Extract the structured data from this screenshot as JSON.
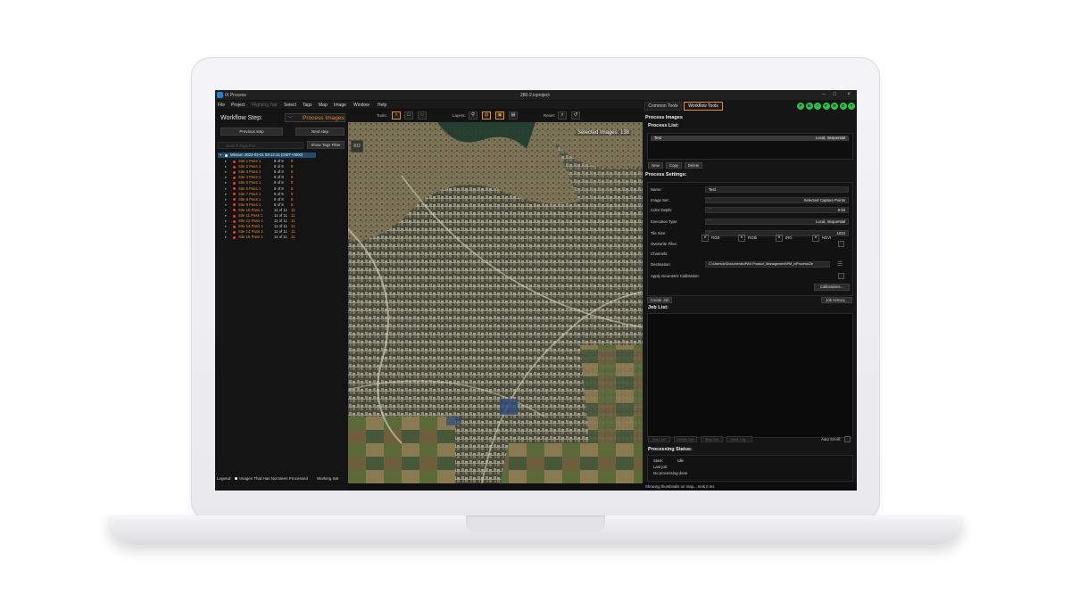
{
  "window": {
    "app_title": "iX Process",
    "project": "280-2.ixproject",
    "min": "–",
    "max": "□",
    "close": "×"
  },
  "menu": [
    "File",
    "Project",
    "Flighting Tab",
    "Select",
    "Tags",
    "Map",
    "Image",
    "Window",
    "Help"
  ],
  "workflow": {
    "label": "Workflow Step:",
    "step": "Process Images",
    "prev": "Previous step",
    "next": "Next step",
    "filter_placeholder": "Search Tags For...",
    "tags_filter": "Show Tags Filter",
    "root": "Mission 2023-03-01 09:13:14 (GMT+0000)"
  },
  "tree": [
    {
      "name": "Site 1 Pass 1",
      "count": "8 of 8",
      "sel": "8"
    },
    {
      "name": "Site 2 Pass 1",
      "count": "8 of 8",
      "sel": "8"
    },
    {
      "name": "Site 3 Pass 1",
      "count": "8 of 8",
      "sel": "8"
    },
    {
      "name": "Site 4 Pass 1",
      "count": "8 of 8",
      "sel": "8"
    },
    {
      "name": "Site 5 Pass 1",
      "count": "8 of 8",
      "sel": "8"
    },
    {
      "name": "Site 6 Pass 1",
      "count": "8 of 8",
      "sel": "8"
    },
    {
      "name": "Site 7 Pass 1",
      "count": "8 of 8",
      "sel": "8"
    },
    {
      "name": "Site 8 Pass 1",
      "count": "8 of 8",
      "sel": "8"
    },
    {
      "name": "Site 9 Pass 1",
      "count": "8 of 8",
      "sel": "8"
    },
    {
      "name": "Site 10 Pass 1",
      "count": "11 of 11",
      "sel": "11"
    },
    {
      "name": "Site 11 Pass 1",
      "count": "11 of 11",
      "sel": "11"
    },
    {
      "name": "Site 12 Pass 1",
      "count": "11 of 11",
      "sel": "11"
    },
    {
      "name": "Site 13 Pass 1",
      "count": "11 of 11",
      "sel": "11"
    },
    {
      "name": "Site 14 Pass 1",
      "count": "11 of 11",
      "sel": "11"
    },
    {
      "name": "Site 15 Pass 1",
      "count": "11 of 11",
      "sel": "11"
    }
  ],
  "legend": {
    "label": "Legend:",
    "item": "Images That Has Not Been Processed",
    "working_set": "Working Set"
  },
  "map_toolbar": {
    "tools": "Tools:",
    "layers": "Layers:",
    "reset": "Reset:",
    "map_btn": "KO",
    "selected": "Selected Images: 138"
  },
  "right": {
    "tab_common": "Common Tools",
    "tab_workflow": "Workflow Tools",
    "circles": [
      "P",
      "M",
      "I",
      "F",
      "R",
      "G",
      "T"
    ],
    "title": "Process Images",
    "process_list": "Process List:",
    "proc_name": "Test",
    "proc_mode": "Local, Sequential",
    "new": "New",
    "copy": "Copy",
    "delete": "Delete",
    "settings_title": "Process Settings:",
    "labels": {
      "name": "Name:",
      "image_set": "Image Set:",
      "color_depth": "Color Depth:",
      "exec_type": "Execution Type:",
      "tile_size": "Tile Size:",
      "overwrite": "Overwrite Files:",
      "channels": "Channels:",
      "destination": "Destination:",
      "geo_cal": "Apply Geometric Calibration:"
    },
    "values": {
      "name": "Test",
      "image_set": "Selected Capture Points",
      "color_depth": "8-bit",
      "exec_type": "Local, Sequential",
      "tile_size": "1024",
      "destination": "C:\\Users\\ic\\Documents\\iPAS Product_Management\\PM_ixProcess\\2e"
    },
    "channels": [
      "RGB",
      "RGBi",
      "IRG",
      "NDVI"
    ],
    "calibrations": "Calibrations...",
    "create_job": "Create Job",
    "job_history": "Job History...",
    "job_list": "Job List:",
    "job_buttons": [
      "Start Job",
      "Delete Job",
      "Stop Job",
      "Save Log..."
    ],
    "auto_scroll": "Auto Scroll:",
    "proc_status": "Processing Status:",
    "state_lbl": "State:",
    "state_val": "Idle",
    "last_job_lbl": "Last job:",
    "last_job_val": "No processing done"
  },
  "statusbar": "Showing thumbnails on map... took 0 ms",
  "colors": {
    "accent": "#e98a2b",
    "status_green": "#2fbf4a",
    "tree_root": "#1f4c6b"
  }
}
